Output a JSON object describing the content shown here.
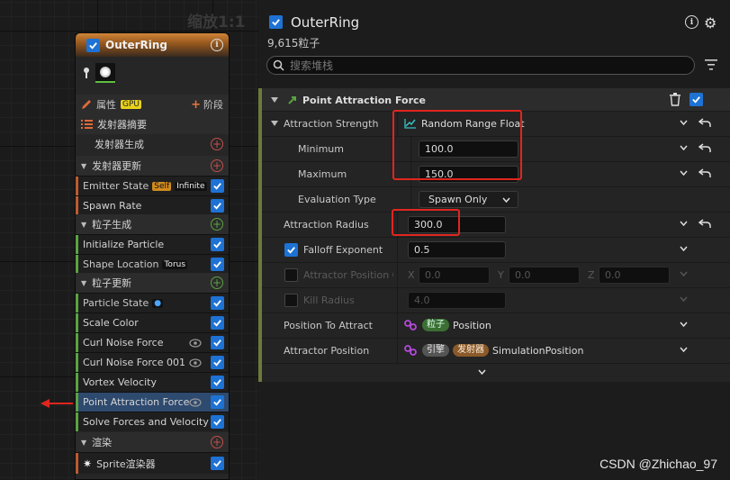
{
  "graph": {
    "zoom_label": "缩放1:1"
  },
  "node": {
    "title": "OuterRing",
    "sections": {
      "properties": "属性",
      "gpu_tag": "GPU",
      "stage_button": "阶段",
      "emitter_summary": "发射器摘要",
      "emitter_spawn": "发射器生成",
      "emitter_update": "发射器更新",
      "particle_spawn": "粒子生成",
      "particle_update": "粒子更新",
      "render": "渲染"
    },
    "items": {
      "emitter_state": "Emitter State",
      "emitter_state_tag1": "Self",
      "emitter_state_tag2": "Infinite",
      "spawn_rate": "Spawn Rate",
      "initialize_particle": "Initialize Particle",
      "shape_location": "Shape Location",
      "shape_location_tag": "Torus",
      "particle_state": "Particle State",
      "scale_color": "Scale Color",
      "curl_noise": "Curl Noise Force",
      "curl_noise_001": "Curl Noise Force 001",
      "vortex_velocity": "Vortex Velocity",
      "point_attraction": "Point Attraction Force",
      "solve_forces": "Solve Forces and Velocity",
      "sprite_renderer": "Sprite渲染器"
    }
  },
  "panel": {
    "title": "OuterRing",
    "particle_count": "9,615粒子",
    "search_placeholder": "搜索堆栈",
    "module_title": "Point Attraction Force",
    "rows": {
      "attraction_strength": "Attraction Strength",
      "attraction_strength_value": "Random Range Float",
      "minimum": "Minimum",
      "minimum_value": "100.0",
      "maximum": "Maximum",
      "maximum_value": "150.0",
      "evaluation_type": "Evaluation Type",
      "evaluation_type_value": "Spawn Only",
      "attraction_radius": "Attraction Radius",
      "attraction_radius_value": "300.0",
      "falloff_exponent": "Falloff Exponent",
      "falloff_exponent_value": "0.5",
      "attractor_position_c": "Attractor Position C",
      "x_label": "X",
      "x_value": "0.0",
      "y_label": "Y",
      "y_value": "0.0",
      "z_label": "Z",
      "z_value": "0.0",
      "kill_radius": "Kill Radius",
      "kill_radius_value": "4.0",
      "position_to_attract": "Position To Attract",
      "position_to_attract_tag": "粒子",
      "position_to_attract_value": "Position",
      "attractor_position": "Attractor Position",
      "attractor_position_tag1": "引擎",
      "attractor_position_tag2": "发射器",
      "attractor_position_value": "SimulationPosition"
    }
  },
  "watermark": "CSDN @Zhichao_97",
  "colors": {
    "accent_blue": "#1e72d4",
    "highlight_red": "#e0261e",
    "emitter_orange": "#d08538"
  }
}
